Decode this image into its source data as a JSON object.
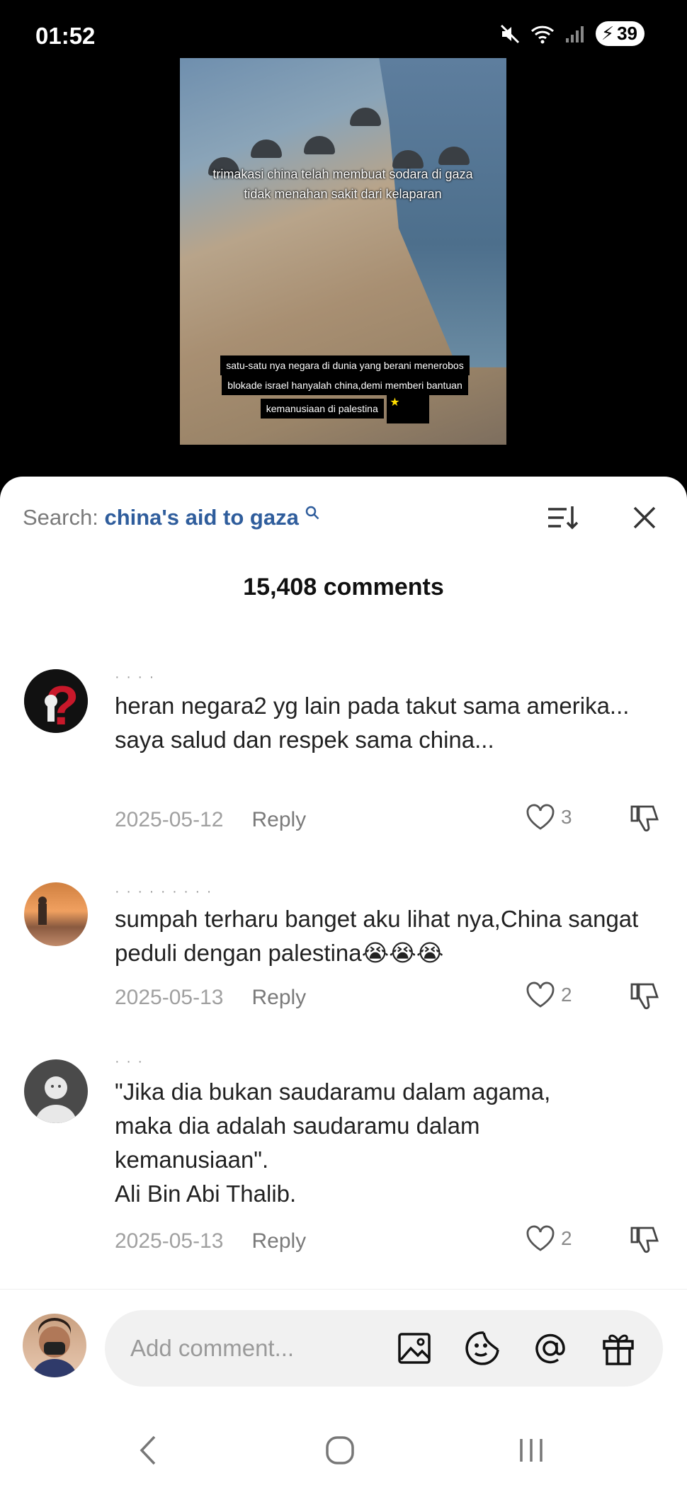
{
  "status": {
    "time": "01:52",
    "battery": "39"
  },
  "video": {
    "caption_top": "trimakasi china telah membuat sodara di gaza tidak menahan sakit dari kelaparan",
    "caption_bottom_1": "satu-satu nya negara di dunia yang berani menerobos",
    "caption_bottom_2": "blokade israel hanyalah china,demi memberi bantuan",
    "caption_bottom_3": "kemanusiaan di palestina"
  },
  "search": {
    "label": "Search: ",
    "query": "china's aid to gaza"
  },
  "comments_count": "15,408 comments",
  "comments": [
    {
      "username": "· · · ·",
      "text": "heran negara2 yg lain pada takut sama amerika... saya salud dan respek sama china...",
      "date": "2025-05-12",
      "reply": "Reply",
      "likes": "3"
    },
    {
      "username": "· · · · · · · · ·",
      "text": "sumpah terharu banget aku lihat nya,China sangat peduli dengan palestina😭😭😭",
      "date": "2025-05-13",
      "reply": "Reply",
      "likes": "2"
    },
    {
      "username": "· · ·",
      "text_lines": [
        "\"Jika dia bukan saudaramu dalam agama,",
        "maka dia adalah saudaramu dalam",
        "kemanusiaan\".",
        "Ali Bin Abi Thalib."
      ],
      "date": "2025-05-13",
      "reply": "Reply",
      "likes": "2"
    }
  ],
  "composer": {
    "placeholder": "Add comment..."
  },
  "colors": {
    "accent": "#2f5d9c",
    "sheet": "#ffffff",
    "input_bg": "#f1f1f1"
  }
}
